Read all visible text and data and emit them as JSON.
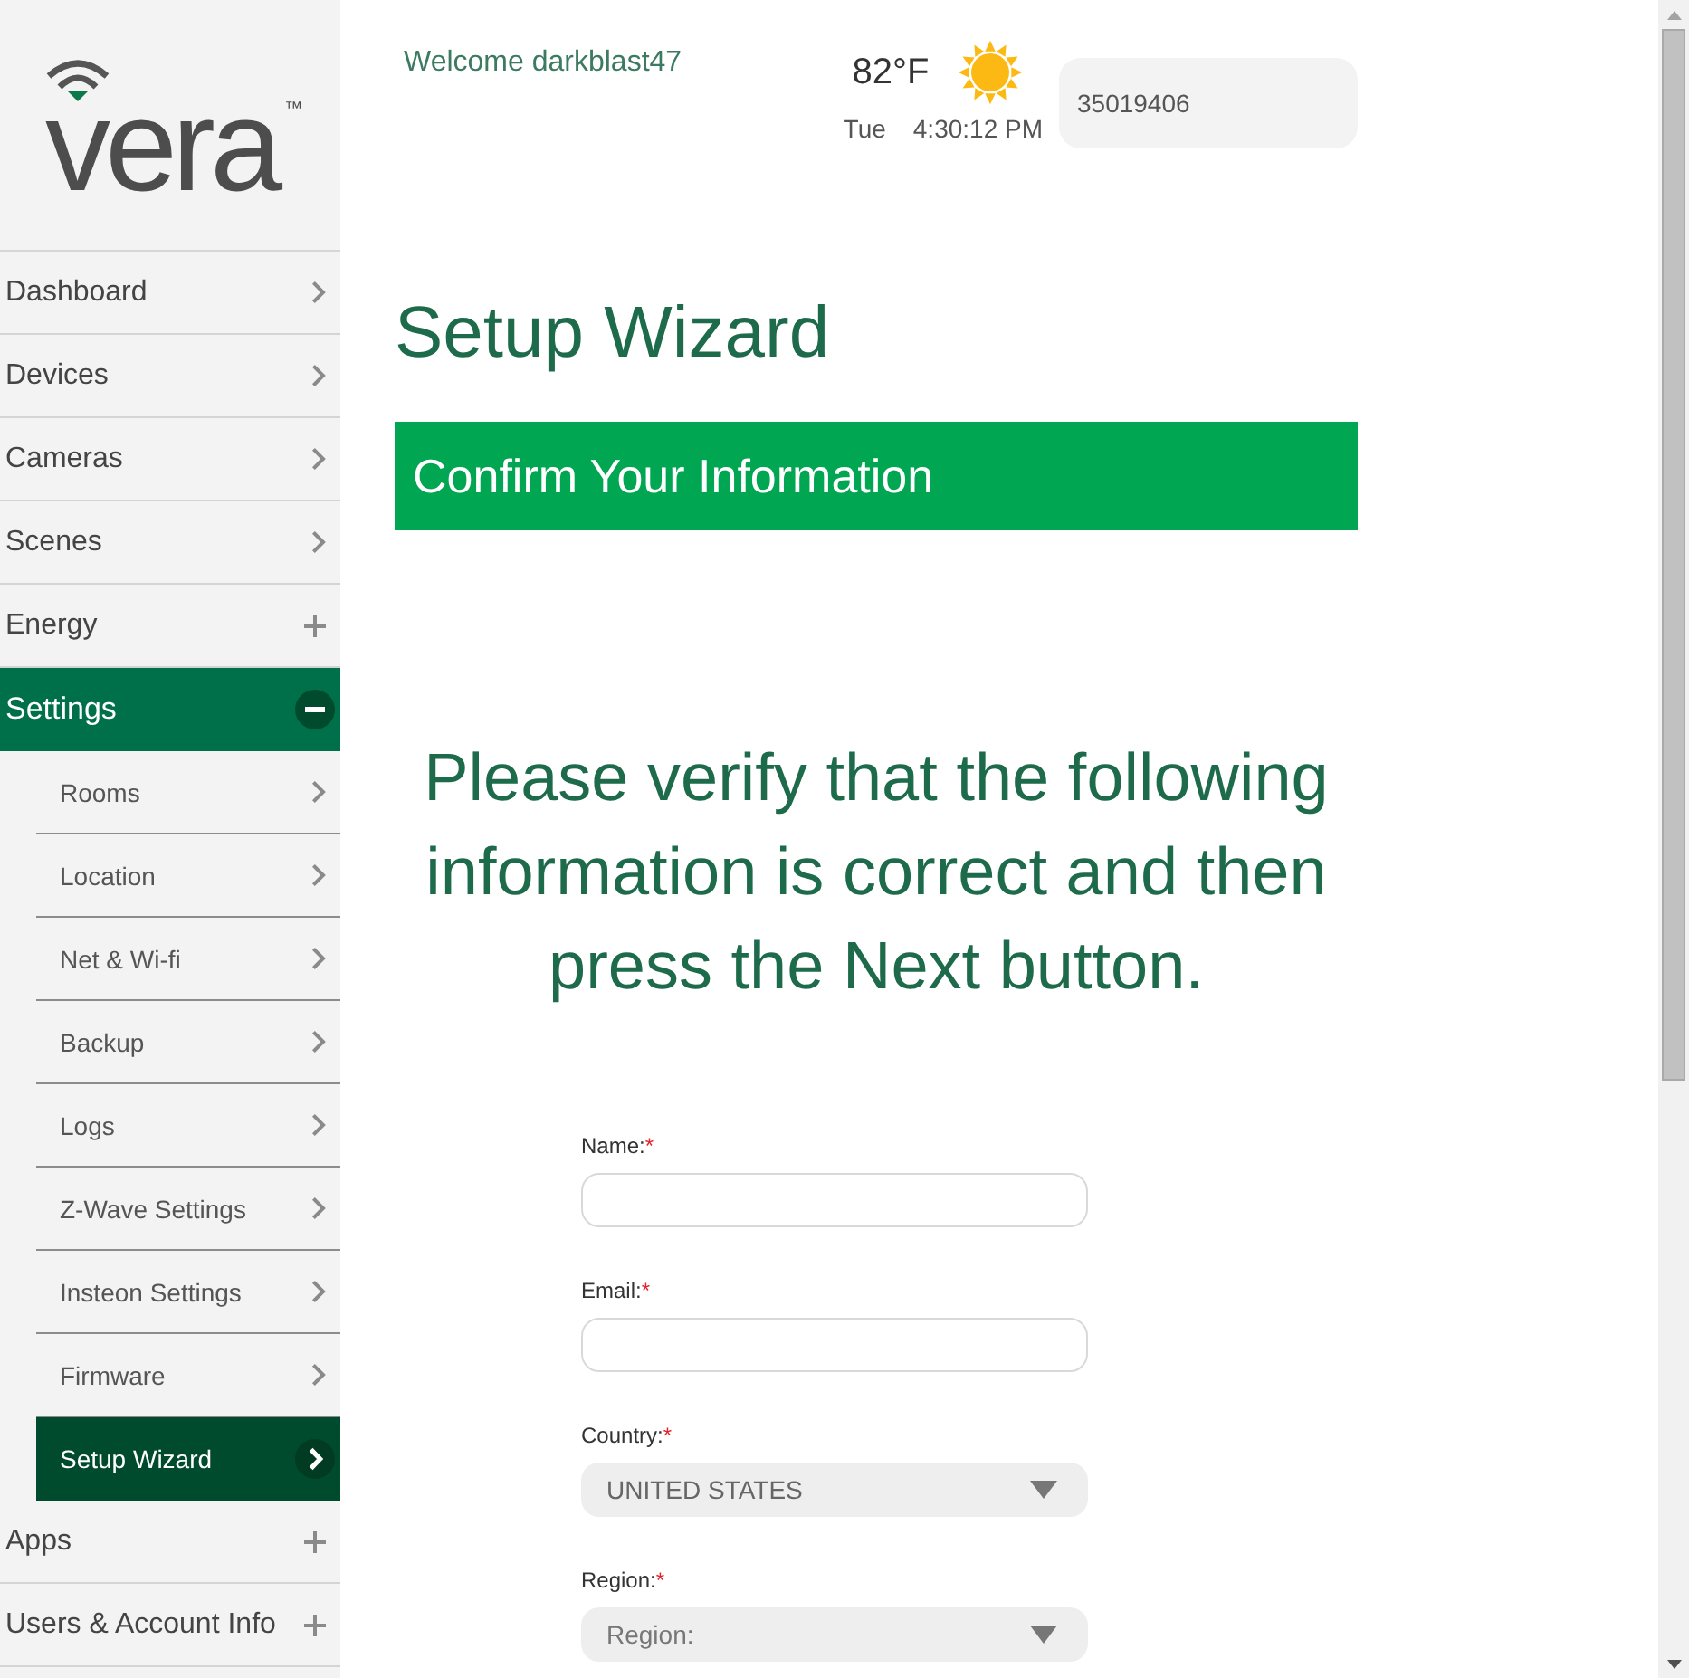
{
  "logo": {
    "wordmark": "vera",
    "trademark": "™"
  },
  "sidebar": {
    "items": [
      {
        "label": "Dashboard",
        "kind": "link",
        "selected": false
      },
      {
        "label": "Devices",
        "kind": "link",
        "selected": false
      },
      {
        "label": "Cameras",
        "kind": "link",
        "selected": false
      },
      {
        "label": "Scenes",
        "kind": "link",
        "selected": false
      },
      {
        "label": "Energy",
        "kind": "group",
        "expanded": false,
        "selected": false
      },
      {
        "label": "Settings",
        "kind": "group",
        "expanded": true,
        "selected": true,
        "children": [
          {
            "label": "Rooms",
            "selected": false
          },
          {
            "label": "Location",
            "selected": false
          },
          {
            "label": "Net & Wi-fi",
            "selected": false
          },
          {
            "label": "Backup",
            "selected": false
          },
          {
            "label": "Logs",
            "selected": false
          },
          {
            "label": "Z-Wave Settings",
            "selected": false
          },
          {
            "label": "Insteon Settings",
            "selected": false
          },
          {
            "label": "Firmware",
            "selected": false
          },
          {
            "label": "Setup Wizard",
            "selected": true
          }
        ]
      },
      {
        "label": "Apps",
        "kind": "group",
        "expanded": false,
        "selected": false
      },
      {
        "label": "Users & Account Info",
        "kind": "group",
        "expanded": false,
        "selected": false
      }
    ]
  },
  "header": {
    "welcome": "Welcome darkblast47",
    "weather": {
      "temperature": "82°F",
      "day": "Tue",
      "time": "4:30:12 PM"
    },
    "controller_id": "35019406"
  },
  "page": {
    "title": "Setup Wizard",
    "step_banner": "Confirm Your Information",
    "instructions": "Please verify that the following information is correct and then press the Next button.",
    "form": {
      "fields": [
        {
          "label": "Name:",
          "required_mark": "*",
          "kind": "text"
        },
        {
          "label": "Email:",
          "required_mark": "*",
          "kind": "text"
        },
        {
          "label": "Country:",
          "required_mark": "*",
          "kind": "select",
          "value": "UNITED STATES"
        },
        {
          "label": "Region:",
          "required_mark": "*",
          "kind": "select",
          "placeholder": "Region:"
        }
      ]
    }
  }
}
